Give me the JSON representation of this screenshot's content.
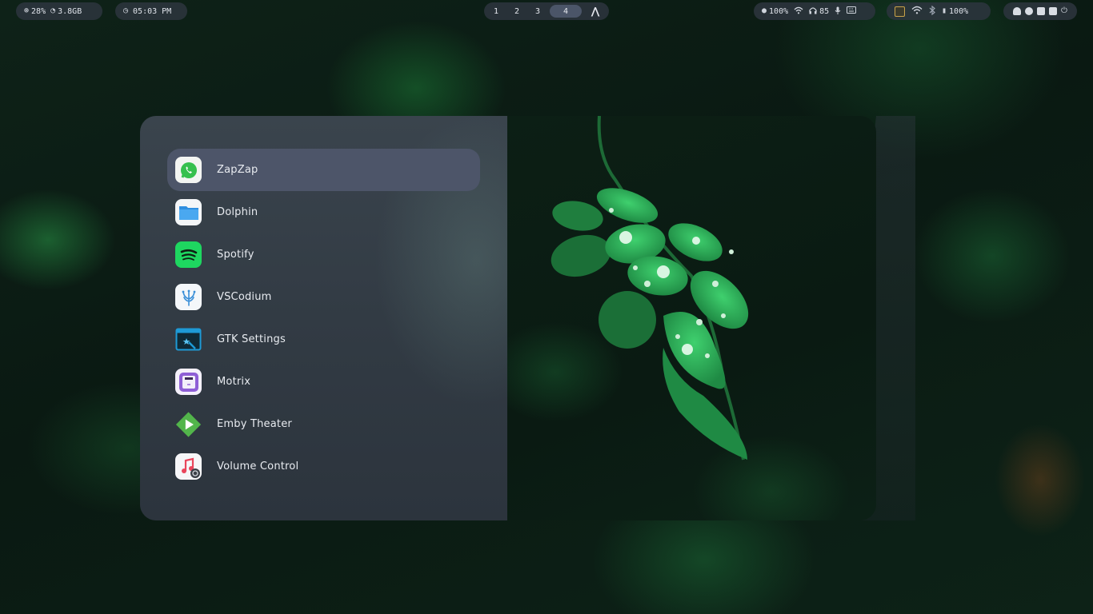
{
  "topbar": {
    "system": {
      "cpu": "28%",
      "memory": "3.8GB"
    },
    "clock": "05:03 PM",
    "workspaces": [
      {
        "label": "1",
        "active": false
      },
      {
        "label": "2",
        "active": false
      },
      {
        "label": "3",
        "active": false
      },
      {
        "label": "4",
        "active": true
      }
    ],
    "workspace_logo": "arch-linux-logo",
    "status": {
      "brightness": "100%",
      "headphones": "85"
    },
    "battery": "100%",
    "icons": [
      "brightness-icon",
      "wifi-icon",
      "headphones-icon",
      "microphone-icon",
      "keyboard-icon",
      "bluetooth-icon",
      "battery-icon",
      "ghost-icon",
      "palette-icon",
      "screenshot-icon",
      "clipboard-icon",
      "power-icon"
    ]
  },
  "launcher": {
    "selected_index": 0,
    "items": [
      {
        "label": "ZapZap",
        "icon": "whatsapp-icon"
      },
      {
        "label": "Dolphin",
        "icon": "folder-icon"
      },
      {
        "label": "Spotify",
        "icon": "spotify-icon"
      },
      {
        "label": "VSCodium",
        "icon": "vscodium-icon"
      },
      {
        "label": "GTK Settings",
        "icon": "gtk-settings-icon"
      },
      {
        "label": "Motrix",
        "icon": "motrix-icon"
      },
      {
        "label": "Emby Theater",
        "icon": "emby-icon"
      },
      {
        "label": "Volume Control",
        "icon": "music-settings-icon"
      }
    ]
  },
  "colors": {
    "panel": "#323b44",
    "selected": "#4d5569",
    "bar": "#2c343e",
    "leaf": "#2fae5a"
  }
}
